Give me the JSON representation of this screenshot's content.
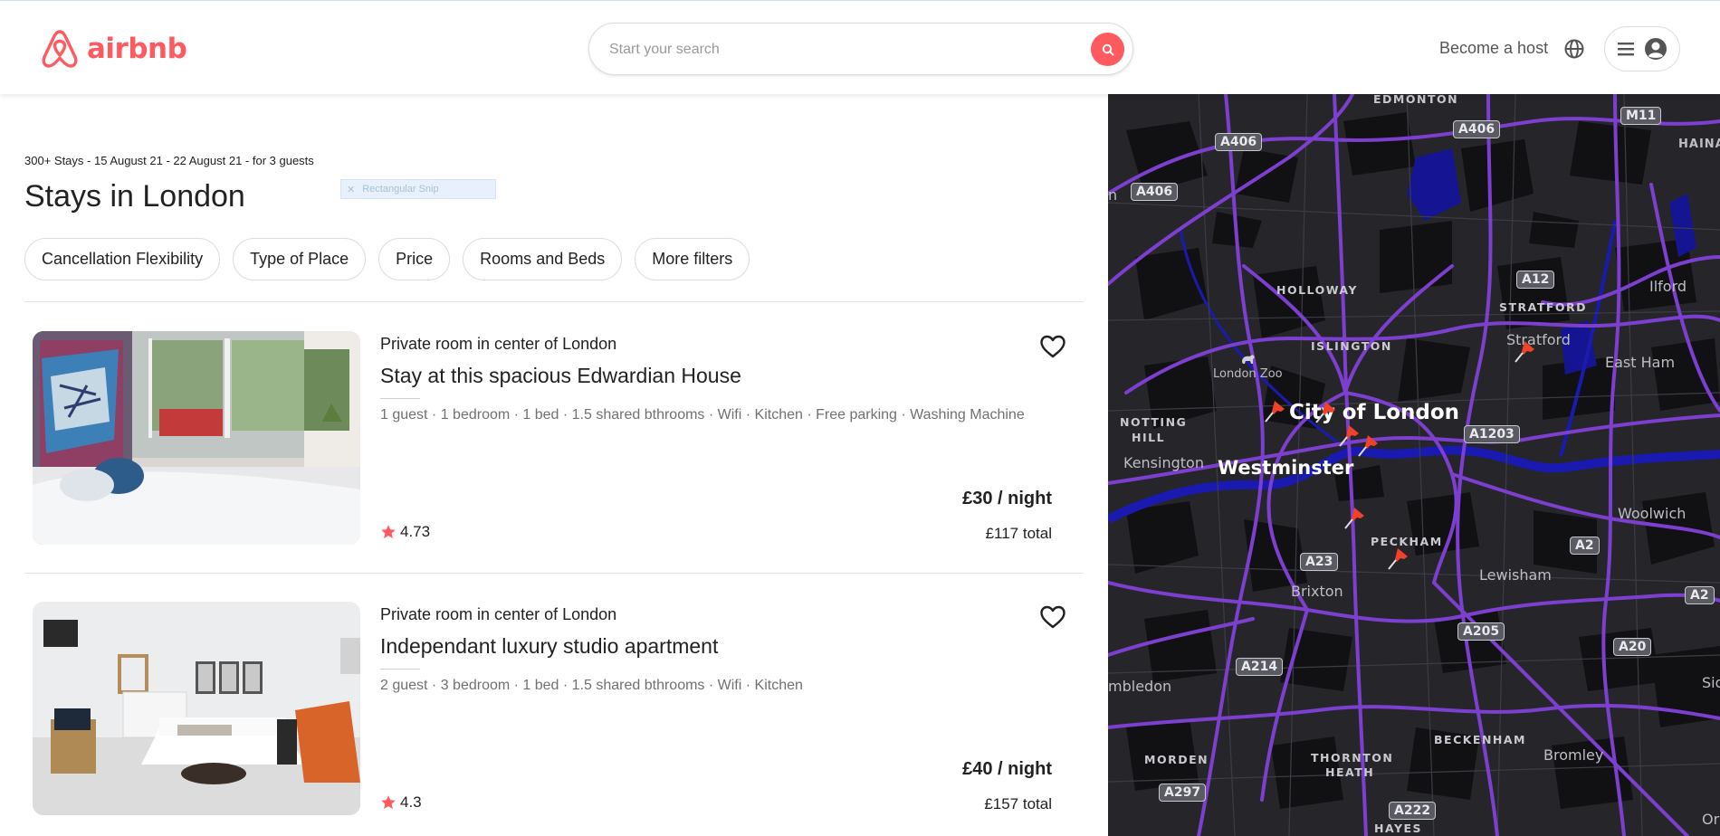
{
  "brand": {
    "name": "airbnb",
    "color": "#ff5a5f"
  },
  "search": {
    "placeholder": "Start your search",
    "value": ""
  },
  "nav": {
    "become_host": "Become a host"
  },
  "results": {
    "summary": "300+ Stays - 15 August 21 - 22 August 21 - for 3 guests",
    "title": "Stays in London",
    "snip_label": "Rectangular Snip"
  },
  "filters": [
    {
      "label": "Cancellation Flexibility"
    },
    {
      "label": "Type of Place"
    },
    {
      "label": "Price"
    },
    {
      "label": "Rooms and Beds"
    },
    {
      "label": "More filters"
    }
  ],
  "listings": [
    {
      "type": "Private room in center of London",
      "title": "Stay at this spacious Edwardian House",
      "amenities": "1 guest · 1 bedroom · 1 bed · 1.5 shared bthrooms · Wifi · Kitchen · Free parking · Washing Machine",
      "price": "£30 / night",
      "total": "£117 total",
      "rating": "4.73"
    },
    {
      "type": "Private room in center of London",
      "title": "Independant luxury studio apartment",
      "amenities": "2 guest · 3 bedroom · 1 bed · 1.5 shared bthrooms · Wifi · Kitchen",
      "price": "£40 / night",
      "total": "£157 total",
      "rating": "4.3"
    }
  ],
  "map": {
    "cities": [
      "City of London",
      "Westminster"
    ],
    "areas": [
      "EDMONTON",
      "HOLLOWAY",
      "ISLINGTON",
      "STRATFORD",
      "NOTTING",
      "HILL",
      "PECKHAM",
      "MORDEN",
      "THORNTON",
      "HEATH",
      "BECKENHAM",
      "HAYES"
    ],
    "towns": [
      "Ilford",
      "Stratford",
      "East Ham",
      "London Zoo",
      "Kensington",
      "Woolwich",
      "Lewisham",
      "Brixton",
      "Bromley",
      "mbledon",
      "HAINAU",
      "Sid",
      "Or",
      "n"
    ],
    "roads": [
      "A406",
      "A406",
      "A406",
      "M11",
      "A12",
      "A1203",
      "A2",
      "A2",
      "A23",
      "A205",
      "A20",
      "A214",
      "A297",
      "A222"
    ]
  }
}
